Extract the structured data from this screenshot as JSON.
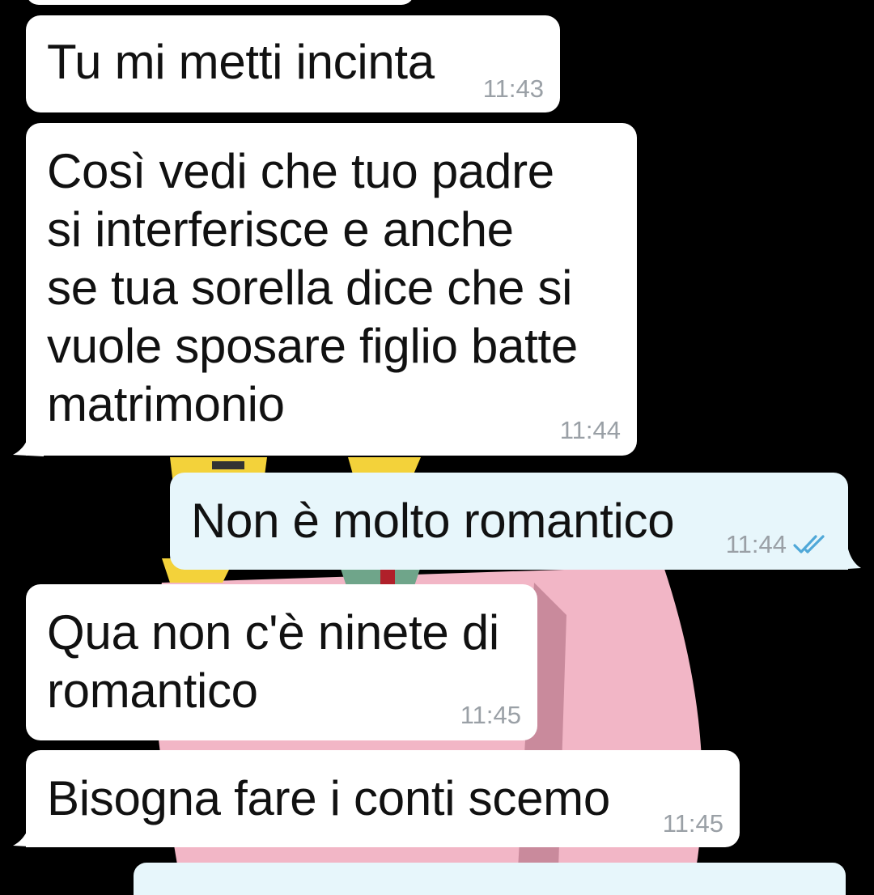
{
  "colors": {
    "background": "#000000",
    "incoming_bubble": "#ffffff",
    "outgoing_bubble": "#e7f6fb",
    "timestamp": "#9aa0a6",
    "read_ticks": "#4fa8d8"
  },
  "conversation": {
    "messages": [
      {
        "direction": "incoming",
        "text": "Tu mi metti incinta",
        "time": "11:43"
      },
      {
        "direction": "incoming",
        "text": "Così vedi che tuo padre\nsi interferisce e anche\nse tua sorella dice che si\nvuole sposare figlio batte\nmatrimonio",
        "time": "11:44"
      },
      {
        "direction": "outgoing",
        "text": "Non è molto romantico",
        "time": "11:44",
        "status_icon": "double-check-read-icon"
      },
      {
        "direction": "incoming",
        "text": "Qua non c'è ninete di\nromantico",
        "time": "11:45"
      },
      {
        "direction": "incoming",
        "text": "Bisogna fare i conti scemo",
        "time": "11:45"
      }
    ]
  }
}
